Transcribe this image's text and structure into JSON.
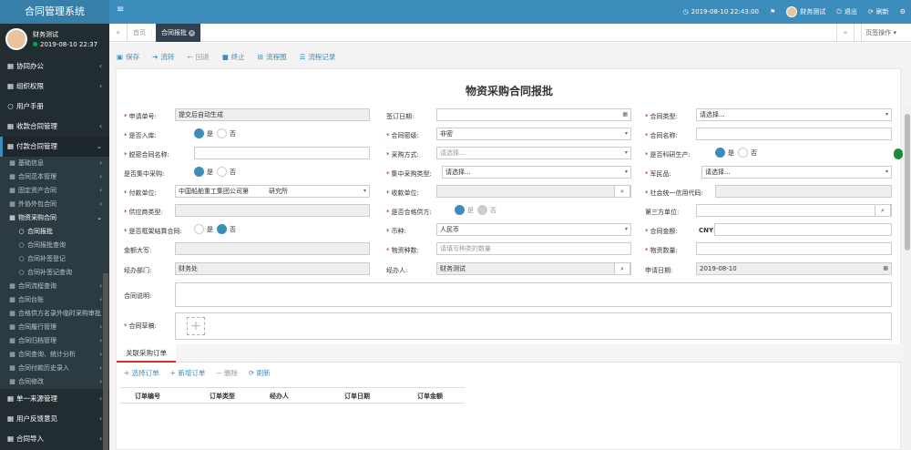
{
  "app": {
    "title": "合同管理系统"
  },
  "top": {
    "menu_icon": "≡",
    "datetime": "2019-08-10 22:43:00",
    "user": "财务测试",
    "logout": "退出",
    "refresh": "刷新"
  },
  "user": {
    "name": "财务测试",
    "datetime": "2019-08-10 22:37"
  },
  "menu": [
    {
      "icon": "▦",
      "label": "协同办公",
      "arrow": "‹"
    },
    {
      "icon": "▦",
      "label": "组织权限",
      "arrow": "‹"
    },
    {
      "icon": "○",
      "label": "用户手册",
      "arrow": ""
    },
    {
      "icon": "▦",
      "label": "收款合同管理",
      "arrow": "‹"
    },
    {
      "icon": "▦",
      "label": "付款合同管理",
      "arrow": "⌄"
    }
  ],
  "submenu": [
    "基础信息",
    "合同范本管理",
    "固定资产合同",
    "外协外包合同",
    "物资采购合同"
  ],
  "subsubmenu": [
    "合同报批",
    "合同报批查询",
    "合同补签登记",
    "合同补签记查询"
  ],
  "submenu2": [
    "合同流程查询",
    "合同台账",
    "合格供方名录外临时采购审批",
    "合同履行管理",
    "合同归档管理",
    "合同查询、统计分析",
    "合同付款历史录入",
    "合同修改"
  ],
  "menu2": [
    {
      "icon": "▦",
      "label": "单一来源管理",
      "arrow": "‹"
    },
    {
      "icon": "▦",
      "label": "用户反馈意见",
      "arrow": "‹"
    },
    {
      "icon": "▦",
      "label": "合同导入",
      "arrow": "‹"
    }
  ],
  "tabs": {
    "prev": "«",
    "home": "首页",
    "active": "合同报批",
    "close": "×",
    "next": "»",
    "ops": "页签操作 ▾"
  },
  "toolbar": {
    "save": "保存",
    "transfer": "流转",
    "back": "回退",
    "stop": "终止",
    "flowchart": "流程图",
    "flowlog": "流程记录"
  },
  "form": {
    "title": "物资采购合同报批",
    "apply_no_label": "申请单号:",
    "apply_no": "提交后自动生成",
    "sign_date_label": "签订日期:",
    "contract_type_label": "合同类型:",
    "contract_type": "请选择...",
    "storage_label": "是否入库:",
    "yes": "是",
    "no": "否",
    "secret_label": "合同密级:",
    "secret": "非密",
    "name_label": "合同名称:",
    "desec_name_label": "脱密合同名称:",
    "purchase_mode_label": "采购方式:",
    "purchase_mode": "请选择...",
    "research_label": "是否科研生产:",
    "central_label": "是否集中采购:",
    "central_type_label": "集中采购类型:",
    "central_type": "请选择...",
    "military_label": "军民品:",
    "military": "请选择...",
    "pay_unit_label": "付款单位:",
    "pay_unit": "中国船舶重工集团公司第",
    "pay_unit_tail": "研究所",
    "recv_unit_label": "收款单位:",
    "credit_code_label": "社会统一信用代码:",
    "supplier_type_label": "供应商类型:",
    "qualified_label": "是否合格供方:",
    "third_label": "第三方单位:",
    "framework_label": "是否框架结算合同:",
    "currency_label": "币种:",
    "currency": "人民币",
    "amount_label": "合同金额:",
    "amount_cur": "CNY",
    "amount_upper_label": "金额大写:",
    "kinds_label": "物资种数:",
    "kinds_ph": "请填写种类的数量",
    "qty_label": "物资数量:",
    "dept_label": "经办部门:",
    "dept": "财务处",
    "handler_label": "经办人:",
    "handler": "财务测试",
    "apply_date_label": "申请日期:",
    "apply_date": "2019-08-10",
    "desc_label": "合同说明:",
    "draft_label": "合同草稿:",
    "plus": "+",
    "select_ph": "请选择..."
  },
  "orders": {
    "section": "关联采购订单",
    "select": "选择订单",
    "add": "新增订单",
    "delete": "删除",
    "refresh": "刷新",
    "columns": [
      "订单编号",
      "订单类型",
      "经办人",
      "订单日期",
      "订单金额"
    ]
  }
}
